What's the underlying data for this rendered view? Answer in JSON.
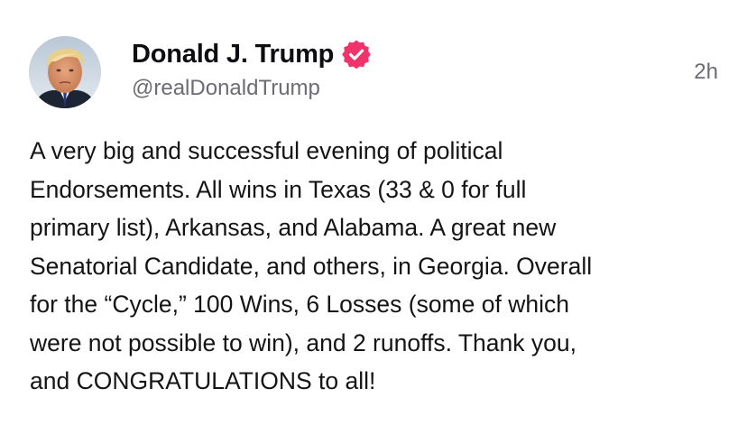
{
  "post": {
    "author": {
      "display_name": "Donald J. Trump",
      "handle": "@realDonaldTrump",
      "verified": true,
      "avatar_icon": "profile-photo",
      "verified_icon": "verified-badge-icon"
    },
    "timestamp": "2h",
    "text": "A very big and successful evening of political\nEndorsements. All wins in Texas (33 & 0 for full\nprimary list), Arkansas, and Alabama. A great new\nSenatorial Candidate, and others, in Georgia. Overall\nfor the “Cycle,” 100 Wins, 6 Losses (some of which\nwere not possible to win), and 2 runoffs. Thank you,\nand CONGRATULATIONS to all!"
  },
  "colors": {
    "verified_badge": "#f0336b",
    "handle_text": "#6b6b73",
    "name_text": "#0d0d12",
    "body_text": "#141414",
    "background": "#ffffff"
  }
}
